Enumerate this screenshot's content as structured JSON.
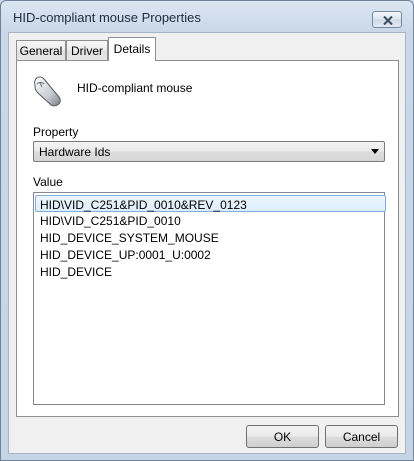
{
  "window": {
    "title": "HID-compliant mouse Properties"
  },
  "tabs": [
    {
      "label": "General"
    },
    {
      "label": "Driver"
    },
    {
      "label": "Details"
    }
  ],
  "details": {
    "device_name": "HID-compliant mouse",
    "property_label": "Property",
    "property_selected": "Hardware Ids",
    "value_label": "Value",
    "values": [
      "HID\\VID_C251&PID_0010&REV_0123",
      "HID\\VID_C251&PID_0010",
      "HID_DEVICE_SYSTEM_MOUSE",
      "HID_DEVICE_UP:0001_U:0002",
      "HID_DEVICE"
    ],
    "selected_index": 0
  },
  "buttons": {
    "ok": "OK",
    "cancel": "Cancel"
  },
  "icons": {
    "device": "mouse-icon",
    "close": "close-icon",
    "dropdown": "chevron-down-icon"
  }
}
